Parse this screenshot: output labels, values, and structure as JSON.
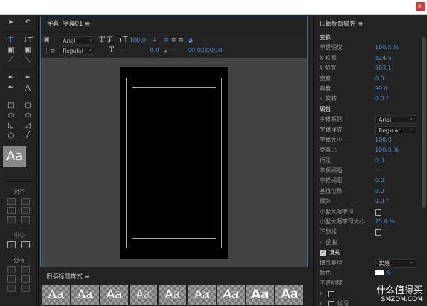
{
  "window": {
    "close_label": "x"
  },
  "tools": {
    "aa_label": "Aa",
    "align_label": "对齐",
    "center_label": "中心",
    "distribute_label": "分布"
  },
  "title_panel": {
    "title": "字幕: 字幕01",
    "menu": "≡",
    "font": "Arial",
    "style": "Regular",
    "size": "100.0",
    "kerning": "0.0",
    "timecode": "00;00;00;00",
    "dash": "—"
  },
  "styles": {
    "title": "旧版标题样式",
    "menu": "≡",
    "swatch": "Aa"
  },
  "props": {
    "title": "旧版标题属性",
    "menu": "≡",
    "transform": "变换",
    "opacity_k": "不透明度",
    "opacity": "100.0 %",
    "x_k": "X 位置",
    "x": "824.5",
    "y_k": "Y 位置",
    "y": "603.1",
    "w_k": "宽度",
    "w": "0.0",
    "h_k": "高度",
    "h": "99.0",
    "rot_k": "旋转",
    "rot": "0.0 °",
    "attrs": "属性",
    "family_k": "字体系列",
    "family": "Arial",
    "style_k": "字体样式",
    "style": "Regular",
    "size_k": "字体大小",
    "size": "100.0",
    "aspect_k": "宽高比",
    "aspect": "100.0 %",
    "leading_k": "行距",
    "leading": "0.0",
    "kern_k": "字偶间距",
    "kern": "—",
    "track_k": "字符间距",
    "track": "0.0",
    "base_k": "基线位移",
    "base": "0.0",
    "slant_k": "倾斜",
    "slant": "0.0 °",
    "smallcaps_k": "小型大写字母",
    "smallcaps_size_k": "小型大写字母大小",
    "smallcaps_size": "75.0 %",
    "underline_k": "下划线",
    "distort_k": "扭曲",
    "fill": "填充",
    "fill_type_k": "填充类型",
    "fill_type": "实底",
    "color_k": "颜色",
    "fill_opacity_k": "不透明度",
    "texture_k": "纹理"
  },
  "watermark": {
    "text": "什么值得买",
    "site": "SMZDM.COM"
  }
}
